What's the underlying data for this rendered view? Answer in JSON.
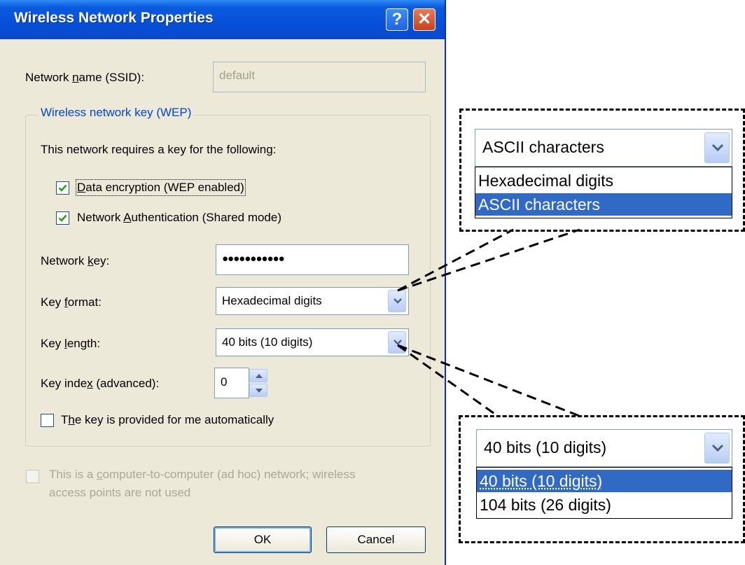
{
  "window": {
    "title": "Wireless Network Properties",
    "help_label": "?",
    "close_label": "✕"
  },
  "ssid": {
    "label_pre": "Network ",
    "label_u": "n",
    "label_post": "ame (SSID):",
    "value": "default"
  },
  "wep_group": {
    "title": "Wireless network key (WEP)",
    "requires_text": "This network requires a key for the following:",
    "data_encryption": {
      "label_u": "D",
      "label_post": "ata encryption (WEP enabled)",
      "checked": true
    },
    "network_auth": {
      "label_pre": "Network ",
      "label_u": "A",
      "label_post": "uthentication (Shared mode)",
      "checked": true
    },
    "network_key": {
      "label_pre": "Network ",
      "label_u": "k",
      "label_post": "ey:",
      "value": "●●●●●●●●●●●"
    },
    "key_format": {
      "label_pre": "Key ",
      "label_u": "f",
      "label_post": "ormat:",
      "value": "Hexadecimal digits"
    },
    "key_length": {
      "label_pre": "Key ",
      "label_u": "l",
      "label_post": "ength:",
      "value": "40 bits (10 digits)"
    },
    "key_index": {
      "label_pre": "Key inde",
      "label_u": "x",
      "label_post": " (advanced):",
      "value": "0"
    },
    "auto_key": {
      "label_pre": "T",
      "label_u": "h",
      "label_post": "e key is provided for me automatically",
      "checked": false
    }
  },
  "adhoc": {
    "line1_pre": "This is a ",
    "line1_u": "c",
    "line1_post": "omputer-to-computer (ad hoc) network; wireless",
    "line2": "access points are not used",
    "checked": false
  },
  "buttons": {
    "ok": "OK",
    "cancel": "Cancel"
  },
  "callout_format": {
    "selected": "ASCII characters",
    "options": [
      "Hexadecimal digits",
      "ASCII characters"
    ],
    "highlighted_index": 1
  },
  "callout_length": {
    "selected": "40 bits (10 digits)",
    "options": [
      "40 bits (10 digits)",
      "104 bits (26 digits)"
    ],
    "highlighted_index": 0
  },
  "colors": {
    "titlebar": "#0550d8",
    "group_title": "#0046d5",
    "selection": "#316ac5",
    "dialog_bg": "#ece9d8"
  }
}
